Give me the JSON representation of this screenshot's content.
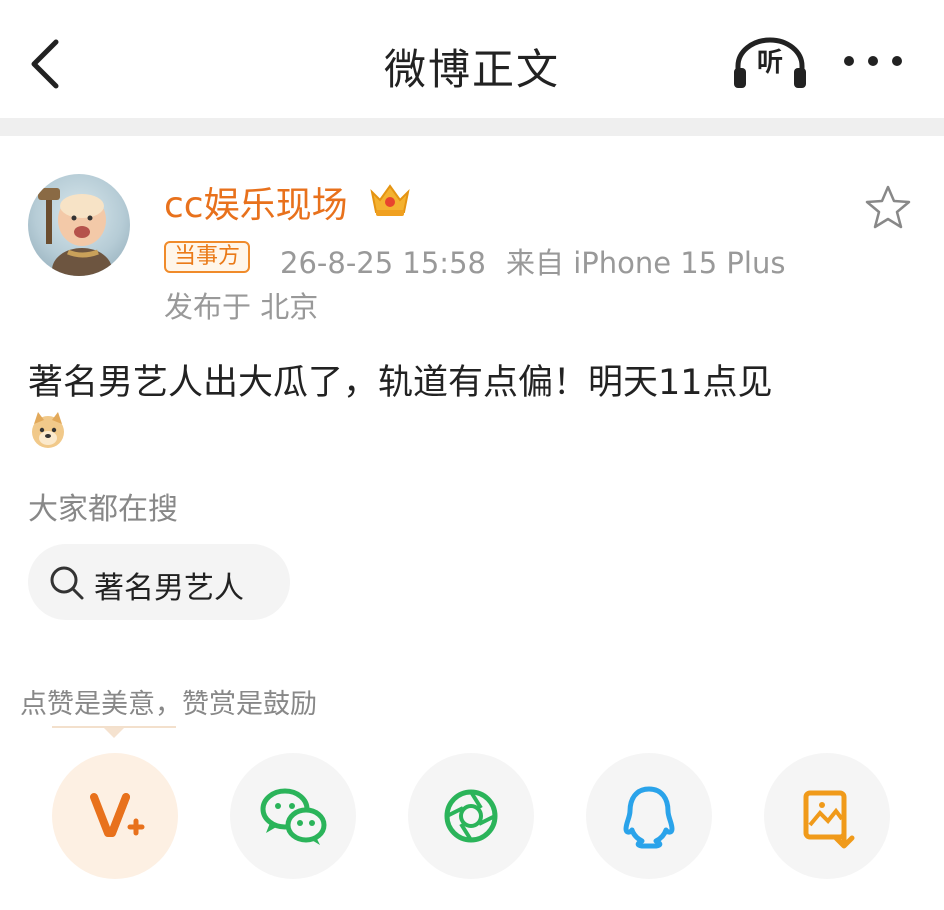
{
  "header": {
    "title": "微博正文",
    "listen_label": "听"
  },
  "post": {
    "username": "cc娱乐现场",
    "badge": "当事方",
    "timestamp": "26-8-25 15:58",
    "source": "来自 iPhone 15 Plus",
    "location": "发布于 北京",
    "text": "著名男艺人出大瓜了，轨道有点偏！明天11点见"
  },
  "search": {
    "heading": "大家都在搜",
    "chip": "著名男艺人"
  },
  "reward": {
    "prompt": "点赞是美意，赞赏是鼓励"
  },
  "share_buttons": [
    {
      "icon": "v-plus-icon",
      "color": "#e8711c"
    },
    {
      "icon": "wechat-icon",
      "color": "#2bb45a"
    },
    {
      "icon": "moments-icon",
      "color": "#2bb45a"
    },
    {
      "icon": "qq-icon",
      "color": "#2aa3ea"
    },
    {
      "icon": "save-image-icon",
      "color": "#f09a1a"
    }
  ],
  "colors": {
    "accent": "#e8711c",
    "muted": "#999999"
  }
}
